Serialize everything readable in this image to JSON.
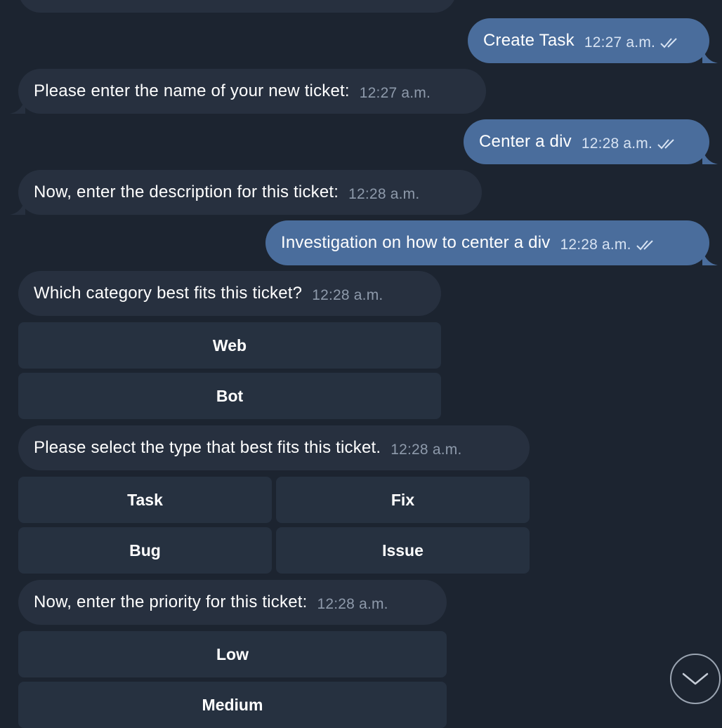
{
  "messages": [
    {
      "dir": "out",
      "text": "Create Task",
      "time": "12:27 a.m."
    },
    {
      "dir": "in",
      "text": "Please enter the name of your new ticket:",
      "time": "12:27 a.m."
    },
    {
      "dir": "out",
      "text": "Center a div",
      "time": "12:28 a.m."
    },
    {
      "dir": "in",
      "text": "Now, enter the description for this ticket:",
      "time": "12:28 a.m."
    },
    {
      "dir": "out",
      "text": "Investigation on how to center a div",
      "time": "12:28 a.m."
    },
    {
      "dir": "in",
      "text": "Which category best fits this ticket?",
      "time": "12:28 a.m."
    },
    {
      "dir": "in",
      "text": "Please select the type that best fits this ticket.",
      "time": "12:28 a.m."
    },
    {
      "dir": "in",
      "text": "Now, enter the priority for this ticket:",
      "time": "12:28 a.m."
    }
  ],
  "keyboards": {
    "category": [
      "Web",
      "Bot"
    ],
    "type": [
      "Task",
      "Fix",
      "Bug",
      "Issue"
    ],
    "priority": [
      "Low",
      "Medium"
    ]
  },
  "icons": {
    "read_receipt": "double-check-icon",
    "scroll_down": "chevron-down-icon"
  },
  "colors": {
    "background": "#1c2430",
    "incoming_bubble": "#27303f",
    "outgoing_bubble": "#4a6d9c",
    "keyboard_button": "#263140"
  }
}
